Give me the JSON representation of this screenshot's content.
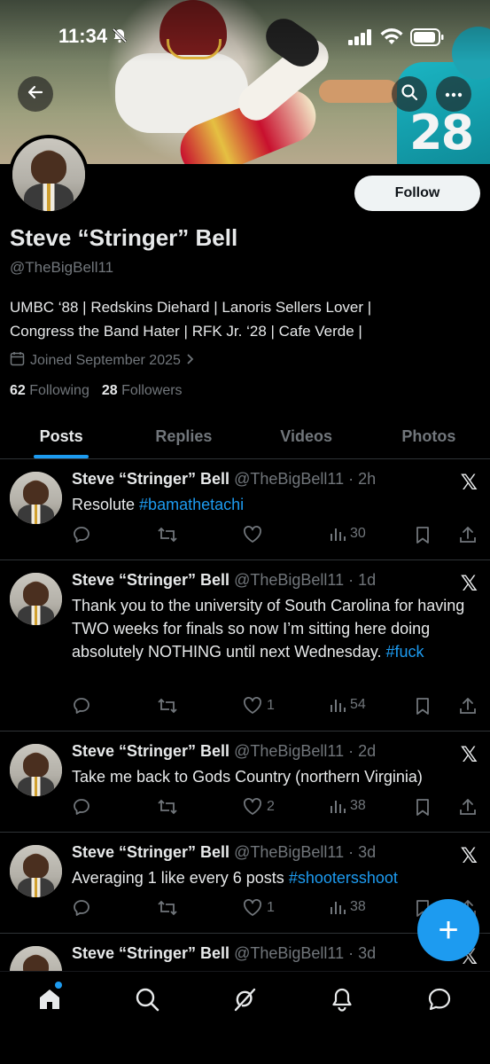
{
  "status_bar": {
    "time": "11:34"
  },
  "profile": {
    "display_name": "Steve “Stringer” Bell",
    "handle": "@TheBigBell11",
    "bio_line1": "UMBC ‘88 | Redskins Diehard | Lanoris Sellers Lover |",
    "bio_line2": "Congress the Band Hater | RFK Jr. ‘28 | Cafe Verde |",
    "joined": "Joined September 2025",
    "following_count": "62",
    "following_label": "Following",
    "followers_count": "28",
    "followers_label": "Followers",
    "follow_button": "Follow",
    "banner_number": "28"
  },
  "tabs": [
    {
      "label": "Posts",
      "active": true
    },
    {
      "label": "Replies",
      "active": false
    },
    {
      "label": "Videos",
      "active": false
    },
    {
      "label": "Photos",
      "active": false
    }
  ],
  "posts": [
    {
      "name": "Steve “Stringer” Bell",
      "meta": "@TheBigBell11 · 2h",
      "text": "Resolute ",
      "hashtag": "#bamathetachi",
      "likes": "",
      "views": "30"
    },
    {
      "name": "Steve “Stringer” Bell",
      "meta": "@TheBigBell11 · 1d",
      "text": "Thank you to the university of South Carolina for having TWO weeks for finals so now I’m sitting here doing absolutely NOTHING until next Wednesday. ",
      "hashtag": "#fuck",
      "likes": "1",
      "views": "54"
    },
    {
      "name": "Steve “Stringer” Bell",
      "meta": "@TheBigBell11 · 2d",
      "text": "Take me back to Gods Country (northern Virginia)",
      "hashtag": "",
      "likes": "2",
      "views": "38"
    },
    {
      "name": "Steve “Stringer” Bell",
      "meta": "@TheBigBell11 · 3d",
      "text": "Averaging 1 like every 6 posts ",
      "hashtag": "#shootersshoot",
      "likes": "1",
      "views": "38"
    },
    {
      "name": "Steve “Stringer” Bell",
      "meta": "@TheBigBell11 · 3d",
      "text": "",
      "hashtag": "",
      "likes": "",
      "views": ""
    }
  ],
  "fab": {
    "icon": "plus-icon",
    "label": "+"
  },
  "bottom_nav": [
    "home-icon",
    "search-icon",
    "grok-icon",
    "notifications-icon",
    "messages-icon"
  ],
  "colors": {
    "accent": "#1d9bf0",
    "background": "#000000",
    "muted": "#71767b",
    "text": "#e7e9ea"
  }
}
